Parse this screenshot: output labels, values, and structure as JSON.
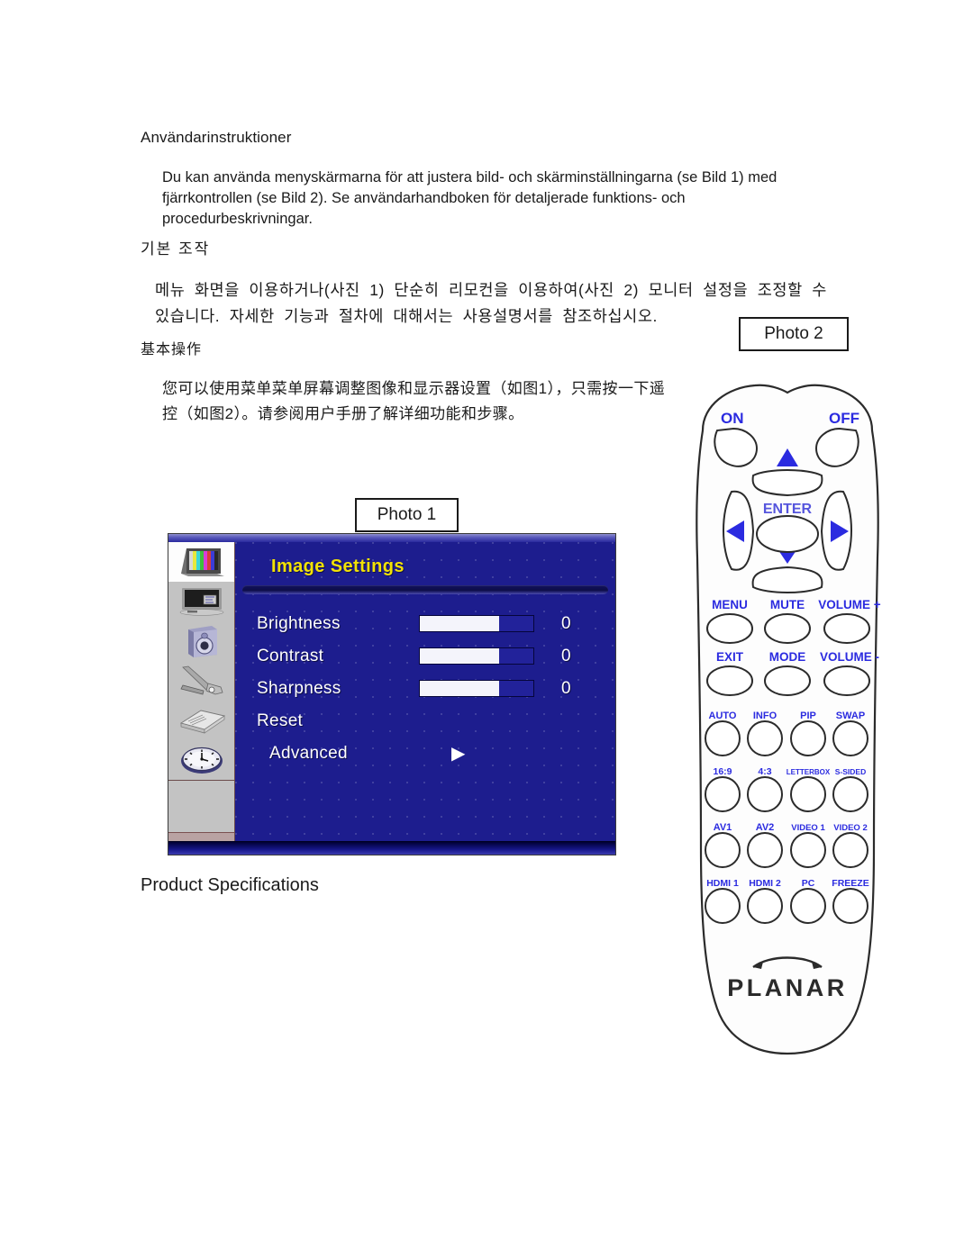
{
  "document": {
    "sections": {
      "swedish": {
        "heading": "Användarinstruktioner",
        "body": "Du kan använda menyskärmarna för att justera bild- och skärminställningarna (se Bild 1) med fjärrkontrollen (se Bild 2). Se användarhandboken för detaljerade funktions- och procedurbeskrivningar."
      },
      "korean": {
        "heading": "기본 조작",
        "body": "메뉴 화면을 이용하거나(사진 1) 단순히 리모컨을 이용하여(사진 2) 모니터 설정을 조정할 수 있습니다. 자세한 기능과 절차에 대해서는 사용설명서를 참조하십시오."
      },
      "chinese": {
        "heading": "基本操作",
        "body": "您可以使用菜单菜单屏幕调整图像和显示器设置（如图1），只需按一下遥控（如图2）。请参阅用户手册了解详细功能和步骤。"
      }
    },
    "product_specifications_heading": "Product Specifications"
  },
  "photo_labels": {
    "photo1": "Photo 1",
    "photo2": "Photo 2"
  },
  "osd": {
    "title": "Image Settings",
    "colors": {
      "background": "#1d1d8e",
      "title_text": "#f2e205",
      "sidebar": "#c3c3c3",
      "slider_fill": "#f4f4fb"
    },
    "sidebar_icons": [
      {
        "name": "picture-colorbars-icon",
        "label": "Image",
        "active": true
      },
      {
        "name": "display-monitor-icon",
        "label": "Display",
        "active": false
      },
      {
        "name": "speaker-audio-icon",
        "label": "Audio",
        "active": false
      },
      {
        "name": "wrench-tool-icon",
        "label": "Setup",
        "active": false
      },
      {
        "name": "open-book-icon",
        "label": "Information",
        "active": false
      },
      {
        "name": "clock-timer-icon",
        "label": "Timer",
        "active": false
      }
    ],
    "rows": [
      {
        "label": "Brightness",
        "type": "slider",
        "value": "0",
        "fill_percent": 70
      },
      {
        "label": "Contrast",
        "type": "slider",
        "value": "0",
        "fill_percent": 70
      },
      {
        "label": "Sharpness",
        "type": "slider",
        "value": "0",
        "fill_percent": 70
      },
      {
        "label": "Reset",
        "type": "action",
        "value": ""
      },
      {
        "label": "Advanced",
        "type": "submenu",
        "value": "▶"
      }
    ]
  },
  "remote": {
    "brand": "PLANAR",
    "power": {
      "on": "ON",
      "off": "OFF"
    },
    "navigation": {
      "enter": "ENTER",
      "up": "▲",
      "down": "▼",
      "left": "◀",
      "right": "▶"
    },
    "rows": [
      [
        "MENU",
        "MUTE",
        "VOLUME +"
      ],
      [
        "EXIT",
        "MODE",
        "VOLUME -"
      ],
      [
        "AUTO",
        "INFO",
        "PIP",
        "SWAP"
      ],
      [
        "16:9",
        "4:3",
        "LETTERBOX",
        "S-SIDED"
      ],
      [
        "AV1",
        "AV2",
        "VIDEO 1",
        "VIDEO 2"
      ],
      [
        "HDMI 1",
        "HDMI 2",
        "PC",
        "FREEZE"
      ]
    ],
    "label_color": "#2b2be0"
  }
}
